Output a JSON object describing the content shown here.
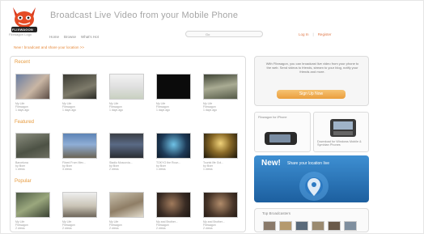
{
  "header": {
    "logo_name": "FLIXWAGON",
    "logo_tagline": "Flixwagon Logo",
    "site_title": "Broadcast Live Video from your Mobile Phone",
    "nav": [
      "Home",
      "Browse",
      "What's Hot"
    ],
    "search_button": "Go",
    "login": "Log In",
    "separator": "|",
    "register": "Register"
  },
  "promo_link": "New ! broadcast and share your location >>",
  "sections": {
    "recent": {
      "title": "Recent",
      "items": [
        {
          "title": "My Life",
          "meta": "Flixwagon\n1 days ago"
        },
        {
          "title": "My Life",
          "meta": "Flixwagon\n1 days ago"
        },
        {
          "title": "My Life",
          "meta": "Flixwagon\n1 days ago"
        },
        {
          "title": "My Life",
          "meta": "Flixwagon\n1 days ago"
        },
        {
          "title": "My Life",
          "meta": "Flixwagon\n1 days ago"
        }
      ]
    },
    "featured": {
      "title": "Featured",
      "items": [
        {
          "title": "Barcelona",
          "meta": "by flixer\n1 views"
        },
        {
          "title": "Flixed From Mex...",
          "meta": "by flixer\n3 views"
        },
        {
          "title": "Stadio Moscovia...",
          "meta": "by flixer\n2 views"
        },
        {
          "title": "TOKYO the Roun...",
          "meta": "by flixer\n1 views"
        },
        {
          "title": "Tourist life Gol...",
          "meta": "by flixer\n1 views"
        }
      ]
    },
    "popular": {
      "title": "Popular",
      "items": [
        {
          "title": "My Life",
          "meta": "Flixwagon\n2 views"
        },
        {
          "title": "My Life",
          "meta": "Flixwagon\n2 views"
        },
        {
          "title": "My Life",
          "meta": "Flixwagon\n2 views"
        },
        {
          "title": "My and Brother...",
          "meta": "Flixwagon\n2 views"
        },
        {
          "title": "My and Brother...",
          "meta": "Flixwagon\n2 views"
        }
      ]
    }
  },
  "sidebar": {
    "intro": "With Flixwagon, you can broadcast live video from your phone to the web. Send videos to friends, stream to your blog, notify your friends and more.",
    "signup_button": "Sign Up Now",
    "phone1_label": "Flixwagon for iPhone",
    "phone2_label": "Download for Windows Mobile & Symbian Phones",
    "banner_title": "New!",
    "banner_sub": "Share your location live",
    "top_title": "Top Broadcasters"
  },
  "colors": {
    "accent_orange": "#e69a3c",
    "banner_blue": "#2a72b8"
  }
}
